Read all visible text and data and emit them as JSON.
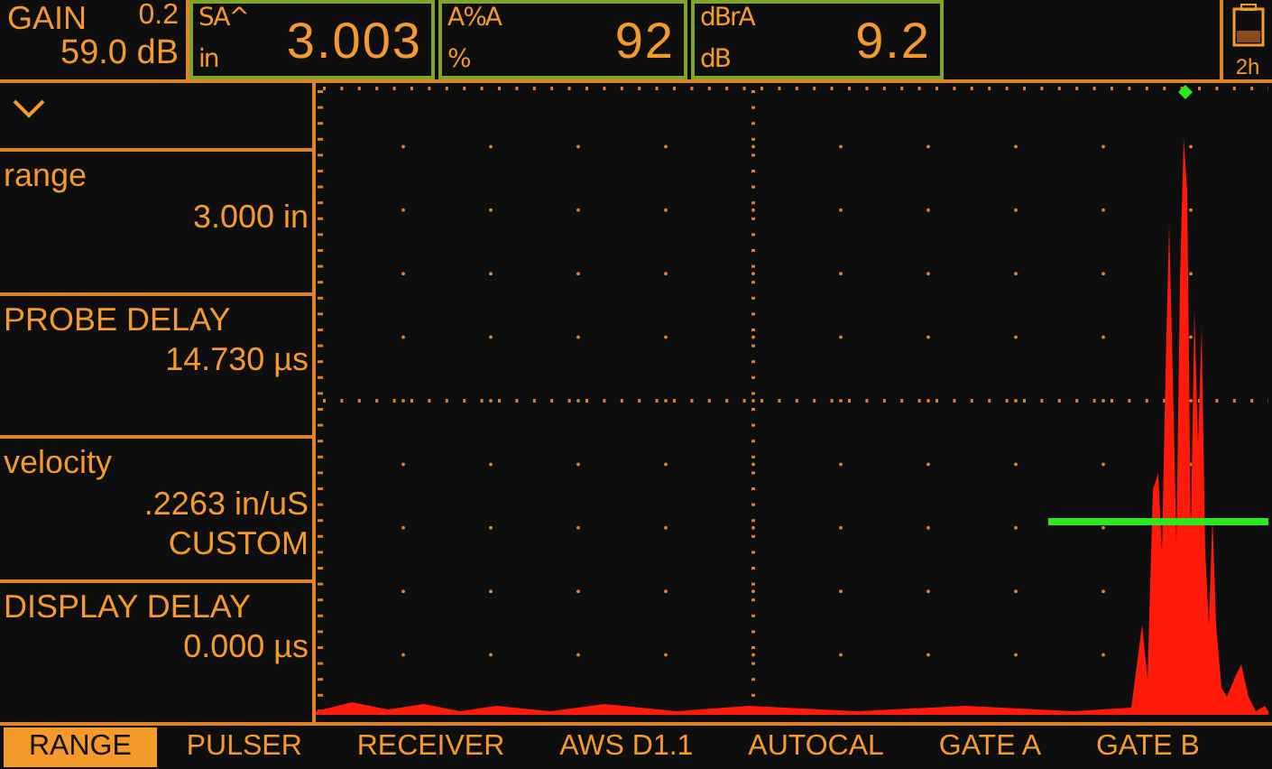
{
  "gain": {
    "label": "GAIN",
    "step": "0.2",
    "value": "59.0 dB"
  },
  "readings": [
    {
      "label": "SA^",
      "unit": "in",
      "value": "3.003"
    },
    {
      "label": "A%A",
      "unit": "%",
      "value": "92"
    },
    {
      "label": "dBrA",
      "unit": "dB",
      "value": "9.2"
    }
  ],
  "battery": {
    "time": "2h"
  },
  "params": [
    {
      "label": "range",
      "values": [
        "3.000 in"
      ]
    },
    {
      "label": "PROBE DELAY",
      "values": [
        "14.730 µs"
      ]
    },
    {
      "label": "velocity",
      "values": [
        ".2263 in/uS",
        "CUSTOM"
      ]
    },
    {
      "label": "DISPLAY DELAY",
      "values": [
        "0.000 µs"
      ]
    }
  ],
  "menu": [
    {
      "label": "RANGE",
      "selected": true
    },
    {
      "label": "PULSER",
      "selected": false
    },
    {
      "label": "RECEIVER",
      "selected": false
    },
    {
      "label": "AWS D1.1",
      "selected": false
    },
    {
      "label": "AUTOCAL",
      "selected": false
    },
    {
      "label": "GATE A",
      "selected": false
    },
    {
      "label": "GATE B",
      "selected": false
    }
  ]
}
